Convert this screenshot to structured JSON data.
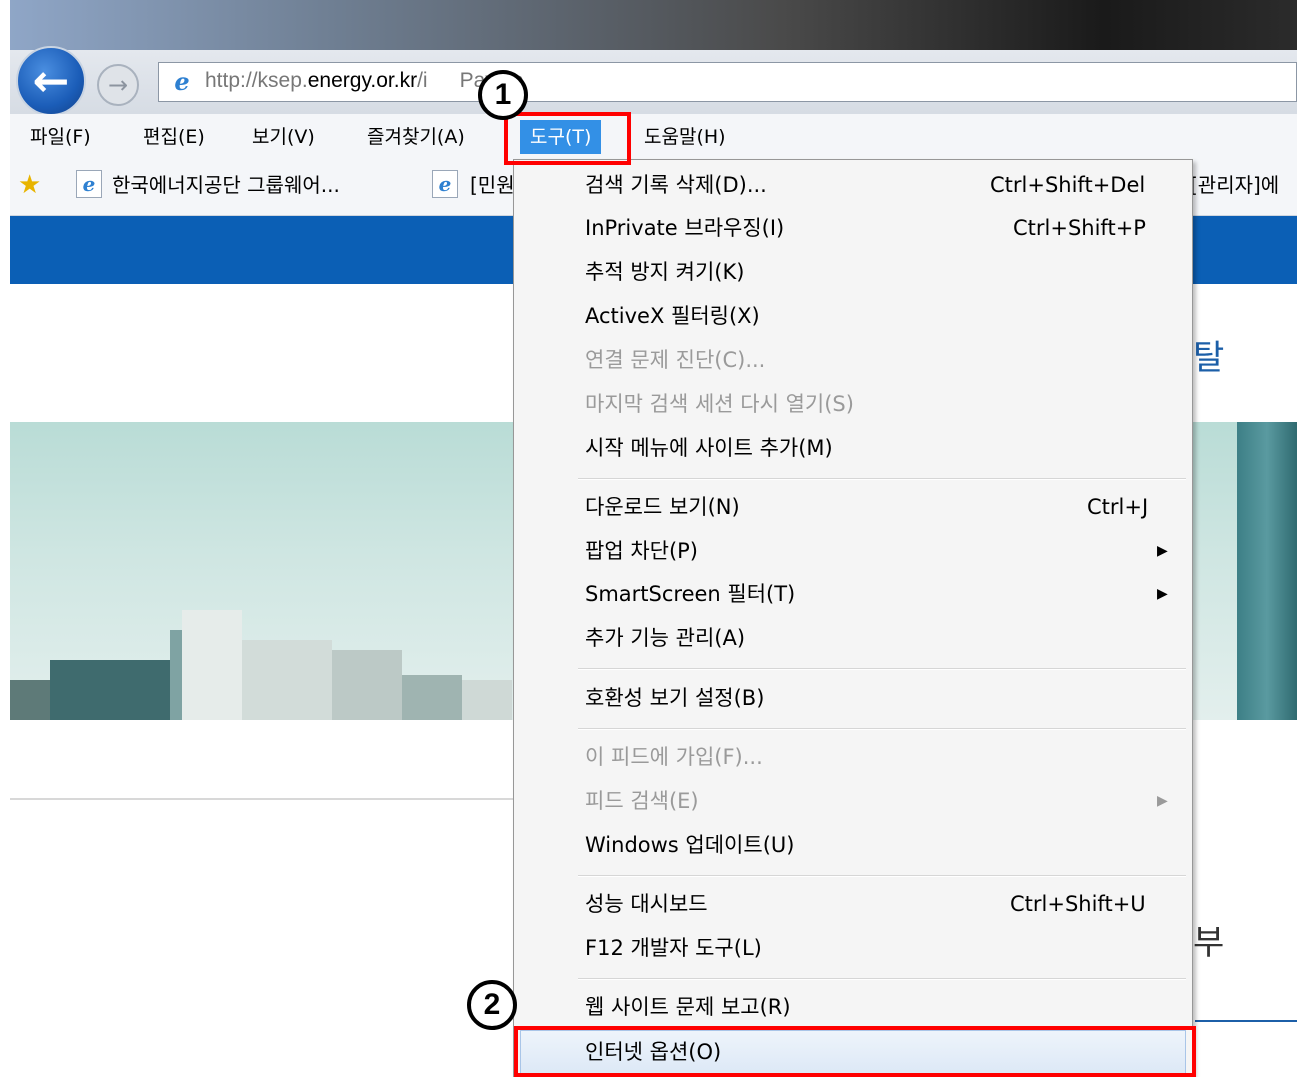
{
  "browser": {
    "address_url_prefix": "http://ksep.",
    "address_url_domain": "energy.or.kr",
    "address_url_suffix": "/i",
    "address_url_tail": "Pay.do",
    "back_icon": "arrow-left-icon",
    "forward_icon": "arrow-right-icon"
  },
  "menubar": {
    "items": [
      {
        "label": "파일(F)"
      },
      {
        "label": "편집(E)"
      },
      {
        "label": "보기(V)"
      },
      {
        "label": "즐겨찾기(A)"
      },
      {
        "label": "도구(T)"
      },
      {
        "label": "도움말(H)"
      }
    ],
    "active_index": 4
  },
  "favorites": {
    "items": [
      {
        "label": "한국에너지공단 그룹웨어..."
      },
      {
        "label": "[민원"
      },
      {
        "label": "[관리자]에"
      }
    ]
  },
  "page": {
    "heading_fragment": "탈",
    "heading_fragment2": "부"
  },
  "tools_menu": {
    "groups": [
      [
        {
          "label": "검색 기록 삭제(D)...",
          "shortcut": "Ctrl+Shift+Del",
          "enabled": true
        },
        {
          "label": "InPrivate 브라우징(I)",
          "shortcut": "Ctrl+Shift+P",
          "enabled": true
        },
        {
          "label": "추적 방지 켜기(K)",
          "enabled": true
        },
        {
          "label": "ActiveX 필터링(X)",
          "enabled": true
        },
        {
          "label": "연결 문제 진단(C)...",
          "enabled": false
        },
        {
          "label": "마지막 검색 세션 다시 열기(S)",
          "enabled": false
        },
        {
          "label": "시작 메뉴에 사이트 추가(M)",
          "enabled": true
        }
      ],
      [
        {
          "label": "다운로드 보기(N)",
          "shortcut": "Ctrl+J",
          "enabled": true
        },
        {
          "label": "팝업 차단(P)",
          "submenu": true,
          "enabled": true
        },
        {
          "label": "SmartScreen 필터(T)",
          "submenu": true,
          "enabled": true
        },
        {
          "label": "추가 기능 관리(A)",
          "enabled": true
        }
      ],
      [
        {
          "label": "호환성 보기 설정(B)",
          "enabled": true
        }
      ],
      [
        {
          "label": "이 피드에 가입(F)...",
          "enabled": false
        },
        {
          "label": "피드 검색(E)",
          "submenu": true,
          "enabled": false
        },
        {
          "label": "Windows 업데이트(U)",
          "enabled": true
        }
      ],
      [
        {
          "label": "성능 대시보드",
          "shortcut": "Ctrl+Shift+U",
          "enabled": true
        },
        {
          "label": "F12 개발자 도구(L)",
          "enabled": true
        }
      ],
      [
        {
          "label": "웹 사이트 문제 보고(R)",
          "enabled": true
        },
        {
          "label": "인터넷 옵션(O)",
          "enabled": true,
          "highlighted": true
        }
      ]
    ]
  },
  "annotations": {
    "step1": "1",
    "step2": "2",
    "highlight_color": "#ff0000"
  }
}
